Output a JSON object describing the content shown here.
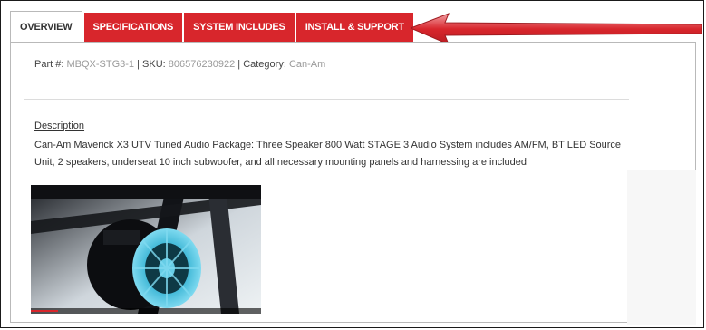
{
  "tabs": [
    {
      "label": "OVERVIEW",
      "active": true
    },
    {
      "label": "SPECIFICATIONS",
      "active": false
    },
    {
      "label": "SYSTEM INCLUDES",
      "active": false
    },
    {
      "label": "INSTALL & SUPPORT",
      "active": false
    }
  ],
  "product_meta": {
    "part_label": "Part #:",
    "part_value": "MBQX-STG3-1",
    "sku_label": "SKU:",
    "sku_value": "806576230922",
    "category_label": "Category:",
    "category_value": "Can-Am",
    "separator": "|"
  },
  "description": {
    "title": "Description",
    "text": "Can-Am Maverick X3 UTV Tuned Audio Package: Three Speaker 800 Watt STAGE 3 Audio System includes AM/FM, BT LED Source Unit, 2 speakers, underseat 10 inch subwoofer, and all necessary mounting panels and harnessing are included"
  },
  "colors": {
    "tab_red": "#d8262c",
    "arrow_red": "#d8262c",
    "speaker_accent": "#3fb7d6"
  },
  "icons": {
    "arrow": "left-arrow-icon",
    "video": "video-thumbnail"
  }
}
